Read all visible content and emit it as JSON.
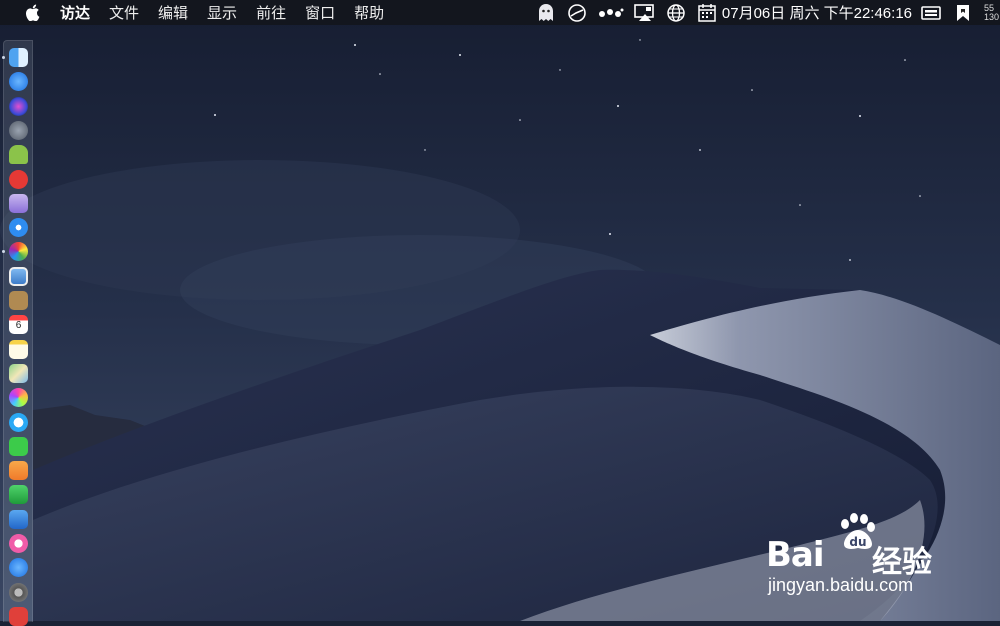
{
  "menubar": {
    "apple_icon": "apple-logo-icon",
    "app_name": "访达",
    "menus": [
      "文件",
      "编辑",
      "显示",
      "前往",
      "窗口",
      "帮助"
    ]
  },
  "status_bar": {
    "icons": [
      "ghost-icon",
      "sync-clock-icon",
      "dots-icon",
      "display-mirror-icon",
      "globe-icon",
      "calendar-icon"
    ],
    "clock": "07月06日 周六 下午22:46:16",
    "net_upload": "55",
    "net_download": "130"
  },
  "dock": {
    "apps": [
      {
        "icon": "finder-icon",
        "running": true
      },
      {
        "icon": "appstore-icon",
        "running": false
      },
      {
        "icon": "siri-icon",
        "running": false
      },
      {
        "icon": "launchpad-rocket-icon",
        "running": false
      },
      {
        "icon": "android-icon",
        "running": false
      },
      {
        "icon": "red-app-icon",
        "running": false
      },
      {
        "icon": "floppy-save-icon",
        "running": false
      },
      {
        "icon": "safari-icon",
        "running": false
      },
      {
        "icon": "color-wheel-icon",
        "running": true
      },
      {
        "icon": "preview-photo-icon",
        "running": false
      },
      {
        "icon": "notebook-icon",
        "running": false
      },
      {
        "icon": "calendar-app-icon",
        "running": false
      },
      {
        "icon": "notes-icon",
        "running": false
      },
      {
        "icon": "maps-icon",
        "running": false
      },
      {
        "icon": "photos-icon",
        "running": false
      },
      {
        "icon": "messages-icon",
        "running": false
      },
      {
        "icon": "facetime-icon",
        "running": false
      },
      {
        "icon": "pages-icon",
        "running": false
      },
      {
        "icon": "numbers-icon",
        "running": false
      },
      {
        "icon": "keynote-icon",
        "running": false
      },
      {
        "icon": "itunes-icon",
        "running": false
      },
      {
        "icon": "app-store-update-icon",
        "running": false
      },
      {
        "icon": "system-preferences-icon",
        "running": false
      },
      {
        "icon": "vivaldi-icon",
        "running": false
      }
    ],
    "calendar_day": "6"
  },
  "watermark": {
    "logo_text": "Bai",
    "brand_text": "经验",
    "url": "jingyan.baidu.com"
  },
  "colors": {
    "sky_top": "#1b2238",
    "dune_light": "#8d95ac",
    "dune_dark": "#1c2440",
    "menubar": "#14161c"
  }
}
